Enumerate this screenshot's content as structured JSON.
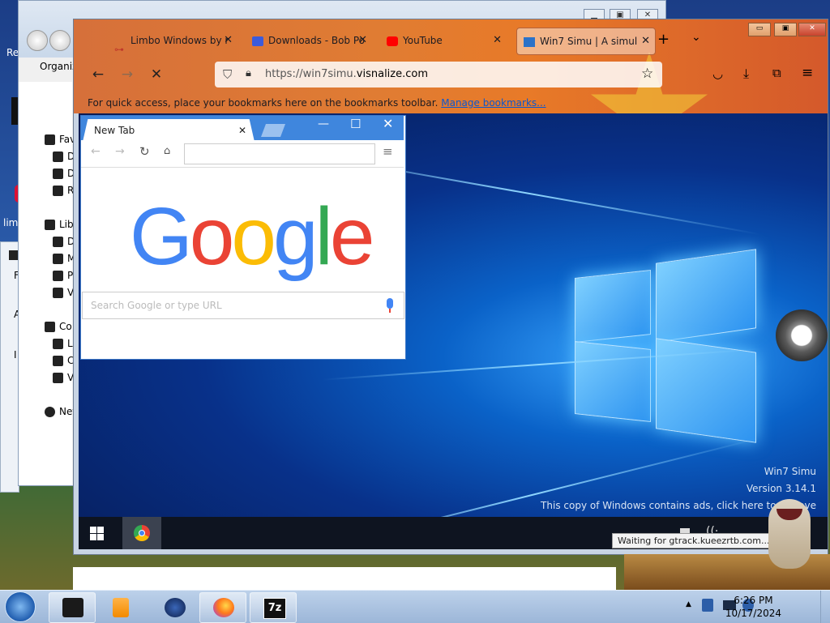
{
  "desktop": {
    "left_labels": [
      "Re",
      "limb"
    ]
  },
  "explorer": {
    "organize_label": "Organiz",
    "tree": {
      "favorites": "Fav",
      "fav_items": [
        "D",
        "D",
        "R"
      ],
      "libraries": "Libi",
      "lib_items": [
        "D",
        "M",
        "P",
        "V"
      ],
      "computer": "Co",
      "comp_items": [
        "L",
        "C",
        "V"
      ],
      "network": "Net"
    },
    "left_strip": [
      "?",
      "F",
      "A",
      "I"
    ]
  },
  "firefox": {
    "tabs": [
      {
        "label": "Limbo Windows by r",
        "favicon": "key-icon",
        "color": "#c0392b"
      },
      {
        "label": "Downloads - Bob Po",
        "favicon": "puzzle-icon",
        "color": "#3b5bdb"
      },
      {
        "label": "YouTube",
        "favicon": "youtube-icon",
        "color": "#ff0000"
      },
      {
        "label": "Win7 Simu | A simul",
        "favicon": "window-icon",
        "color": "#2b72c8",
        "active": true
      }
    ],
    "new_tab_symbol": "+",
    "tab_list_symbol": "⌄",
    "window_controls": {
      "minimize": "▭",
      "maximize": "▣",
      "close": "✕"
    },
    "url_prefix": "https://win7simu.",
    "url_domain": "visnalize.com",
    "bookmarks_message": "For quick access, place your bookmarks here on the bookmarks toolbar.",
    "bookmarks_link": "Manage bookmarks..."
  },
  "simu": {
    "watermark_title": "Win7 Simu",
    "watermark_version": "Version 3.14.1",
    "watermark_ads": "This copy of Windows contains ads, click here to remove",
    "status_tip": "Waiting for gtrack.kueezrtb.com..."
  },
  "chrome": {
    "tab_label": "New Tab",
    "window_controls": {
      "minimize": "—",
      "maximize": "☐",
      "close": "✕"
    },
    "search_placeholder": "Search Google or type URL",
    "logo": [
      "G",
      "o",
      "o",
      "g",
      "l",
      "e"
    ],
    "logo_colors": [
      "#4285f4",
      "#ea4335",
      "#fbbc05",
      "#4285f4",
      "#34a853",
      "#ea4335"
    ]
  },
  "taskbar": {
    "clock_time": "6:26 PM",
    "clock_date": "10/17/2024",
    "seven_zip_label": "7z"
  }
}
